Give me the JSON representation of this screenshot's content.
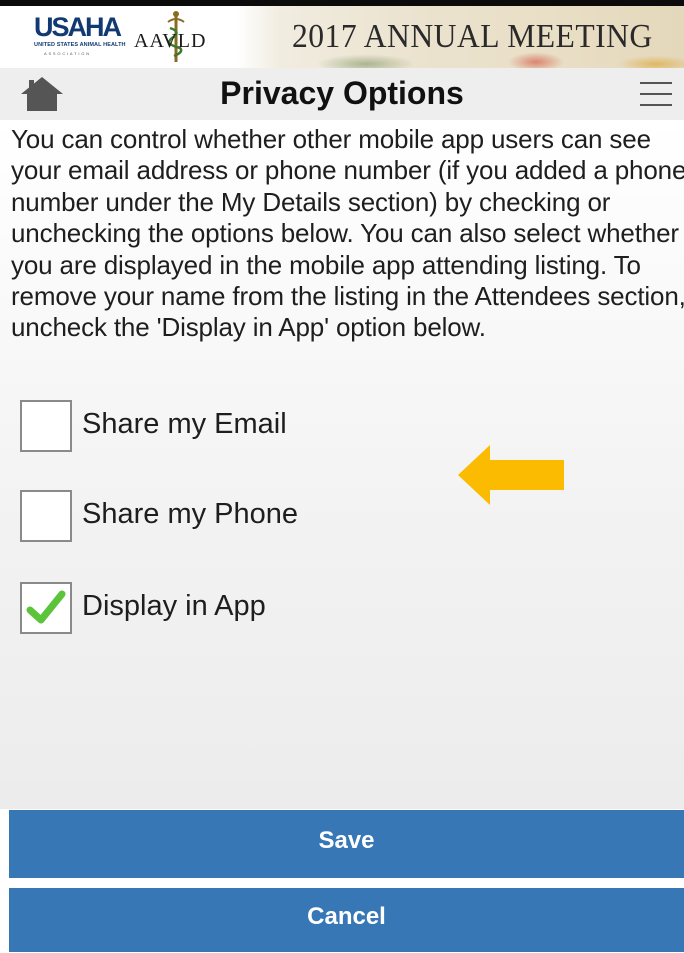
{
  "banner": {
    "org_logo_text": "USAHA",
    "org_logo_subtitle": "UNITED STATES ANIMAL HEALTH",
    "org_logo_subtitle2": "ASSOCIATION",
    "partner_logo_text": "AAVLD",
    "event_title": "2017 ANNUAL MEETING"
  },
  "header": {
    "home_icon": "home-icon",
    "title": "Privacy Options",
    "menu_icon": "hamburger-menu-icon"
  },
  "content": {
    "intro_text": "You can control whether other mobile app users can see your email address or phone number (if you added a phone number under the My Details section) by checking or unchecking the options below. You can also select whether you are displayed in the mobile app attending listing. To remove your name from the listing in the Attendees section, uncheck the 'Display in App' option below.",
    "options": [
      {
        "label": "Share my Email",
        "checked": false
      },
      {
        "label": "Share my Phone",
        "checked": false
      },
      {
        "label": "Display in App",
        "checked": true
      }
    ],
    "annotation_icon": "left-arrow-icon"
  },
  "actions": {
    "save_label": "Save",
    "cancel_label": "Cancel"
  },
  "colors": {
    "button_bg": "#3777b5",
    "logo_blue": "#123a72",
    "arrow_yellow": "#fbbb00",
    "check_green": "#5cc43a"
  }
}
